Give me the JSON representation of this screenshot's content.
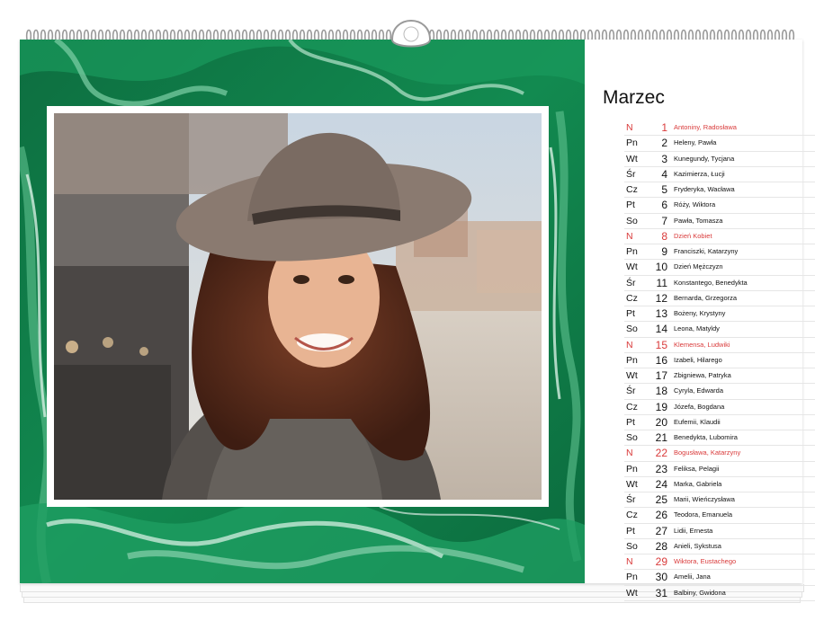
{
  "accent_color": "#d93a3a",
  "marble_colors": [
    "#0f7a48",
    "#1a9a5c",
    "#5fc290",
    "#d6efe2"
  ],
  "calendar": {
    "month": "Marzec",
    "days": [
      {
        "dow": "N",
        "day": "1",
        "names": "Antoniny, Radosława",
        "sunday": true
      },
      {
        "dow": "Pn",
        "day": "2",
        "names": "Heleny, Pawła",
        "sunday": false
      },
      {
        "dow": "Wt",
        "day": "3",
        "names": "Kunegundy, Tycjana",
        "sunday": false
      },
      {
        "dow": "Śr",
        "day": "4",
        "names": "Kazimierza, Łucji",
        "sunday": false
      },
      {
        "dow": "Cz",
        "day": "5",
        "names": "Fryderyka, Wacława",
        "sunday": false
      },
      {
        "dow": "Pt",
        "day": "6",
        "names": "Róży, Wiktora",
        "sunday": false
      },
      {
        "dow": "So",
        "day": "7",
        "names": "Pawła, Tomasza",
        "sunday": false
      },
      {
        "dow": "N",
        "day": "8",
        "names": "Dzień Kobiet",
        "sunday": true
      },
      {
        "dow": "Pn",
        "day": "9",
        "names": "Franciszki, Katarzyny",
        "sunday": false
      },
      {
        "dow": "Wt",
        "day": "10",
        "names": "Dzień Mężczyzn",
        "sunday": false
      },
      {
        "dow": "Śr",
        "day": "11",
        "names": "Konstantego, Benedykta",
        "sunday": false
      },
      {
        "dow": "Cz",
        "day": "12",
        "names": "Bernarda, Grzegorza",
        "sunday": false
      },
      {
        "dow": "Pt",
        "day": "13",
        "names": "Bożeny, Krystyny",
        "sunday": false
      },
      {
        "dow": "So",
        "day": "14",
        "names": "Leona, Matyldy",
        "sunday": false
      },
      {
        "dow": "N",
        "day": "15",
        "names": "Klemensa, Ludwiki",
        "sunday": true
      },
      {
        "dow": "Pn",
        "day": "16",
        "names": "Izabeli, Hilarego",
        "sunday": false
      },
      {
        "dow": "Wt",
        "day": "17",
        "names": "Zbigniewa, Patryka",
        "sunday": false
      },
      {
        "dow": "Śr",
        "day": "18",
        "names": "Cyryla, Edwarda",
        "sunday": false
      },
      {
        "dow": "Cz",
        "day": "19",
        "names": "Józefa, Bogdana",
        "sunday": false
      },
      {
        "dow": "Pt",
        "day": "20",
        "names": "Eufemii, Klaudii",
        "sunday": false
      },
      {
        "dow": "So",
        "day": "21",
        "names": "Benedykta, Lubomira",
        "sunday": false
      },
      {
        "dow": "N",
        "day": "22",
        "names": "Bogusława, Katarzyny",
        "sunday": true
      },
      {
        "dow": "Pn",
        "day": "23",
        "names": "Feliksa, Pelagii",
        "sunday": false
      },
      {
        "dow": "Wt",
        "day": "24",
        "names": "Marka, Gabriela",
        "sunday": false
      },
      {
        "dow": "Śr",
        "day": "25",
        "names": "Marii, Wieńczysława",
        "sunday": false
      },
      {
        "dow": "Cz",
        "day": "26",
        "names": "Teodora, Emanuela",
        "sunday": false
      },
      {
        "dow": "Pt",
        "day": "27",
        "names": "Lidii, Ernesta",
        "sunday": false
      },
      {
        "dow": "So",
        "day": "28",
        "names": "Anieli, Sykstusa",
        "sunday": false
      },
      {
        "dow": "N",
        "day": "29",
        "names": "Wiktora, Eustachego",
        "sunday": true
      },
      {
        "dow": "Pn",
        "day": "30",
        "names": "Amelii, Jana",
        "sunday": false
      },
      {
        "dow": "Wt",
        "day": "31",
        "names": "Balbiny, Gwidona",
        "sunday": false
      }
    ]
  }
}
